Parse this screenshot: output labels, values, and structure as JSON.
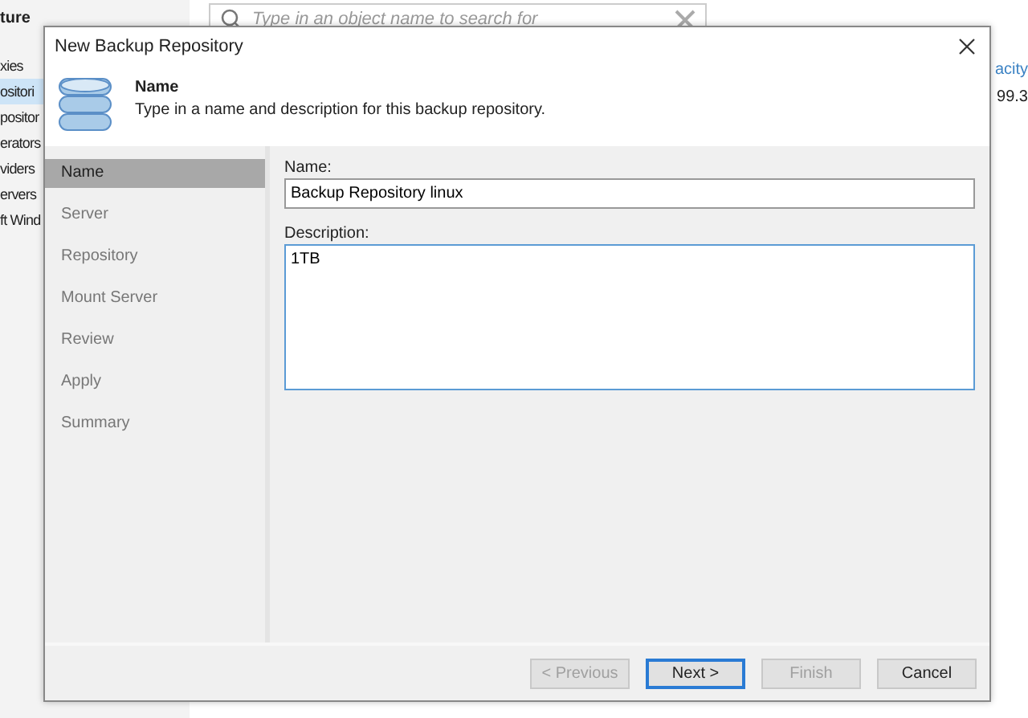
{
  "background": {
    "sidebar": {
      "heading": "ture",
      "items": [
        {
          "label": "xies",
          "selected": false
        },
        {
          "label": "ositori",
          "selected": true
        },
        {
          "label": "positor",
          "selected": false
        },
        {
          "label": "erators",
          "selected": false
        },
        {
          "label": "viders",
          "selected": false
        },
        {
          "label": "ervers",
          "selected": false
        },
        {
          "label": "ft Wind",
          "selected": false
        }
      ]
    },
    "search": {
      "placeholder": "Type in an object name to search for"
    },
    "column_header": "acity",
    "cell": "99.3"
  },
  "dialog": {
    "title": "New Backup Repository",
    "header": {
      "title": "Name",
      "subtitle": "Type in a name and description for this backup repository."
    },
    "steps": [
      {
        "label": "Name",
        "selected": true
      },
      {
        "label": "Server",
        "selected": false
      },
      {
        "label": "Repository",
        "selected": false
      },
      {
        "label": "Mount Server",
        "selected": false
      },
      {
        "label": "Review",
        "selected": false
      },
      {
        "label": "Apply",
        "selected": false
      },
      {
        "label": "Summary",
        "selected": false
      }
    ],
    "name_field": {
      "label": "Name:",
      "value": "Backup Repository linux"
    },
    "description_field": {
      "label": "Description:",
      "value": "1TB"
    },
    "buttons": [
      {
        "label": "< Previous",
        "disabled": true,
        "focused": false
      },
      {
        "label": "Next >",
        "disabled": false,
        "focused": true
      },
      {
        "label": "Finish",
        "disabled": true,
        "focused": false
      },
      {
        "label": "Cancel",
        "disabled": false,
        "focused": false
      }
    ]
  }
}
